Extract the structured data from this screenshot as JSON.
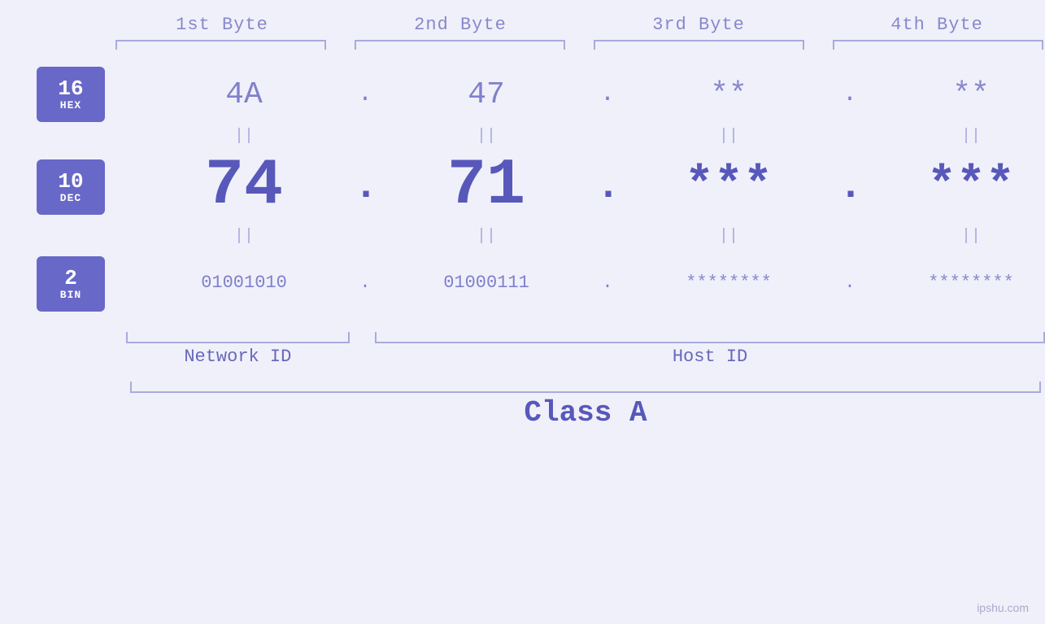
{
  "headers": {
    "byte1": "1st Byte",
    "byte2": "2nd Byte",
    "byte3": "3rd Byte",
    "byte4": "4th Byte"
  },
  "bases": {
    "hex": {
      "number": "16",
      "name": "HEX"
    },
    "dec": {
      "number": "10",
      "name": "DEC"
    },
    "bin": {
      "number": "2",
      "name": "BIN"
    }
  },
  "rows": {
    "hex": {
      "b1": "4A",
      "b2": "47",
      "b3": "**",
      "b4": "**"
    },
    "dec": {
      "b1": "74",
      "b2": "71",
      "b3": "***",
      "b4": "***"
    },
    "bin": {
      "b1": "01001010",
      "b2": "01000111",
      "b3": "********",
      "b4": "********"
    }
  },
  "separators": {
    "dot": ".",
    "equals": "||"
  },
  "labels": {
    "network_id": "Network ID",
    "host_id": "Host ID",
    "class": "Class A"
  },
  "watermark": "ipshu.com"
}
